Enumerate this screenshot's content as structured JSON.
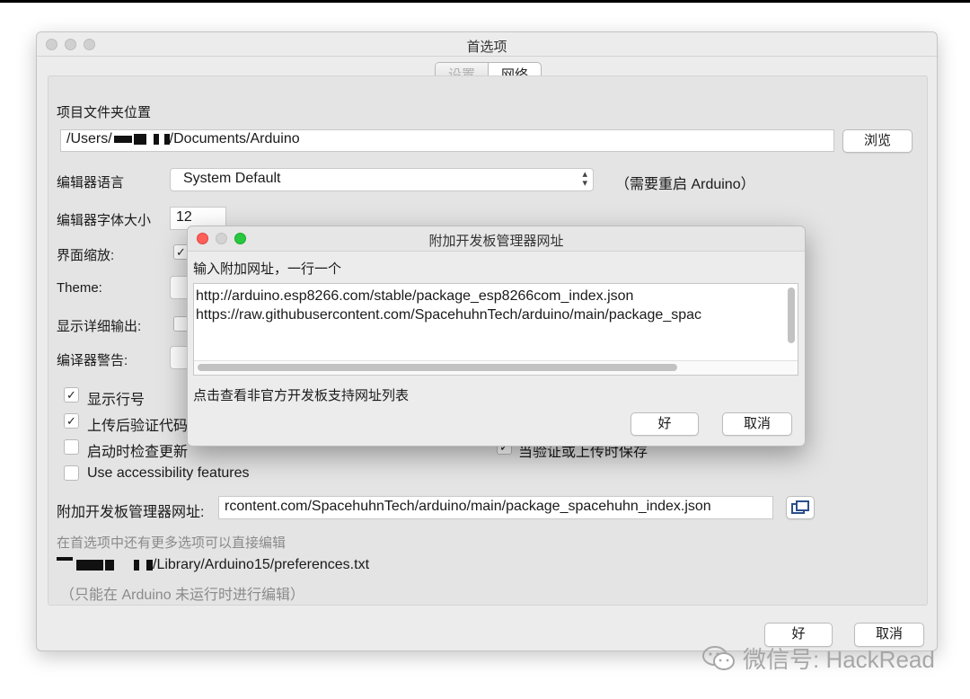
{
  "window": {
    "title": "首选项"
  },
  "tabs": [
    {
      "label": "设置"
    },
    {
      "label": "网络"
    }
  ],
  "settings": {
    "sketchbook_label": "项目文件夹位置",
    "sketchbook_path_prefix": "/Users/",
    "sketchbook_path_suffix": "/Documents/Arduino",
    "browse_button": "浏览",
    "editor_language_label": "编辑器语言",
    "editor_language_value": "System Default",
    "restart_note": "（需要重启 Arduino）",
    "font_size_label": "编辑器字体大小",
    "font_size_value": "12",
    "scale_label": "界面缩放:",
    "theme_label": "Theme:",
    "verbose_label": "显示详细输出:",
    "warnings_label": "编译器警告:",
    "checkboxes": [
      {
        "label": "显示行号",
        "checked": "✓"
      },
      {
        "label": "上传后验证代码",
        "checked": "✓"
      },
      {
        "label": "启动时检查更新",
        "checked": ""
      },
      {
        "label": "Use accessibility features",
        "checked": ""
      }
    ],
    "save_on_verify_label": "当验证或上传时保存",
    "boards_url_label": "附加开发板管理器网址:",
    "boards_url_value": "rcontent.com/SpacehuhnTech/arduino/main/package_spacehuhn_index.json",
    "more_prefs_note": "在首选项中还有更多选项可以直接编辑",
    "prefs_path_suffix": "/Library/Arduino15/preferences.txt",
    "edit_note": "（只能在 Arduino 未运行时进行编辑）",
    "ok_button": "好",
    "cancel_button": "取消"
  },
  "dialog": {
    "title": "附加开发板管理器网址",
    "prompt": "输入附加网址，一行一个",
    "urls": [
      "http://arduino.esp8266.com/stable/package_esp8266com_index.json",
      "https://raw.githubusercontent.com/SpacehuhnTech/arduino/main/package_spac"
    ],
    "link_text": "点击查看非官方开发板支持网址列表",
    "ok_button": "好",
    "cancel_button": "取消"
  },
  "watermark": {
    "text": "微信号: HackRead"
  }
}
